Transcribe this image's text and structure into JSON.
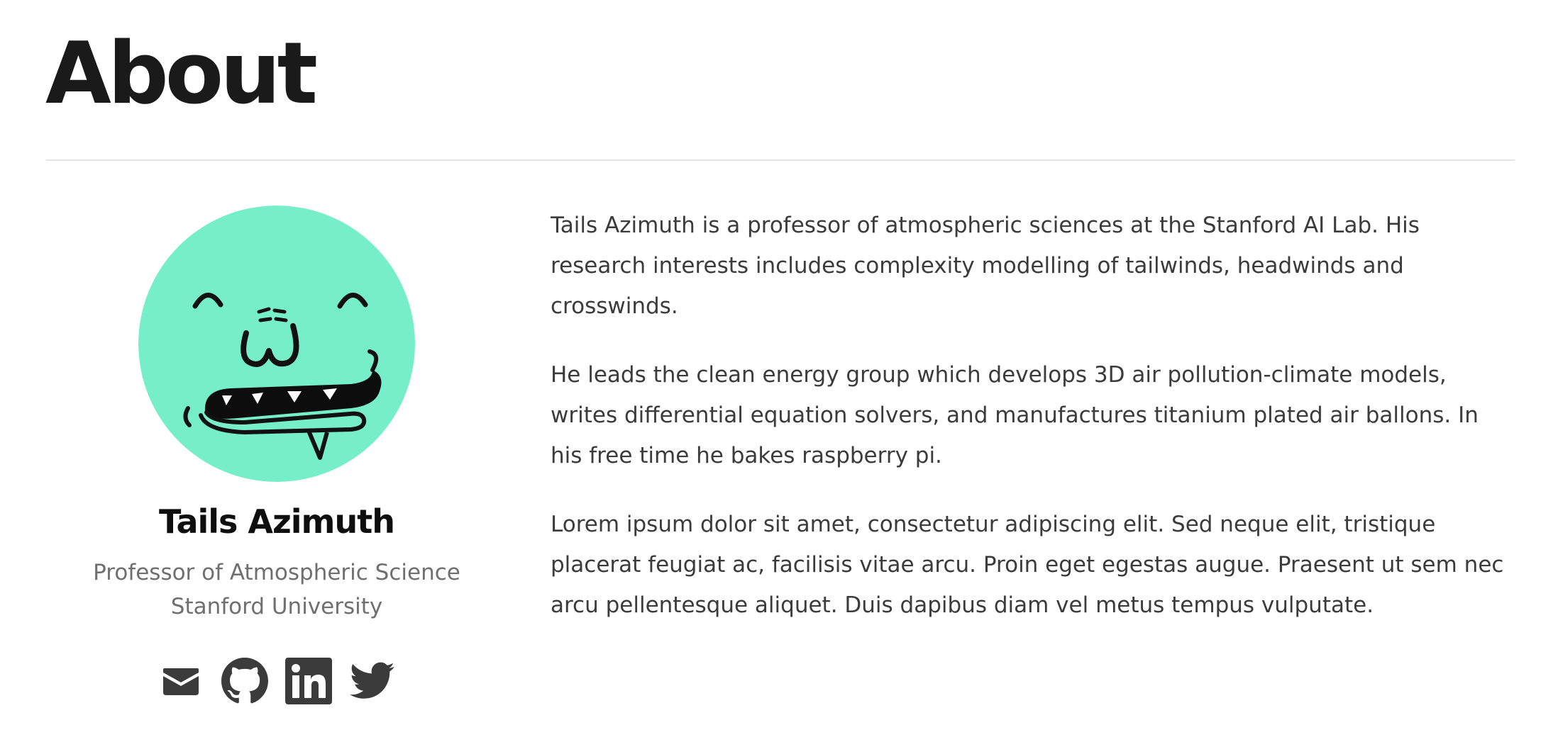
{
  "page": {
    "title": "About"
  },
  "profile": {
    "name": "Tails Azimuth",
    "role": "Professor of Atmospheric Science",
    "organization": "Stanford University",
    "avatar_color": "#76efc8",
    "avatar_icon": "monster-face-avatar"
  },
  "social_links": [
    {
      "icon": "mail-icon",
      "label": "Email"
    },
    {
      "icon": "github-icon",
      "label": "GitHub"
    },
    {
      "icon": "linkedin-icon",
      "label": "LinkedIn"
    },
    {
      "icon": "twitter-icon",
      "label": "Twitter"
    }
  ],
  "bio": {
    "paragraphs": [
      "Tails Azimuth is a professor of atmospheric sciences at the Stanford AI Lab. His research interests includes complexity modelling of tailwinds, headwinds and crosswinds.",
      "He leads the clean energy group which develops 3D air pollution-climate models, writes differential equation solvers, and manufactures titanium plated air ballons. In his free time he bakes raspberry pi.",
      "Lorem ipsum dolor sit amet, consectetur adipiscing elit. Sed neque elit, tristique placerat feugiat ac, facilisis vitae arcu. Proin eget egestas augue. Praesent ut sem nec arcu pellentesque aliquet. Duis dapibus diam vel metus tempus vulputate."
    ]
  },
  "colors": {
    "text": "#1d1d1d",
    "muted": "#6f6f6f",
    "icon": "#3b3b3b",
    "divider": "#e5e5e5"
  }
}
